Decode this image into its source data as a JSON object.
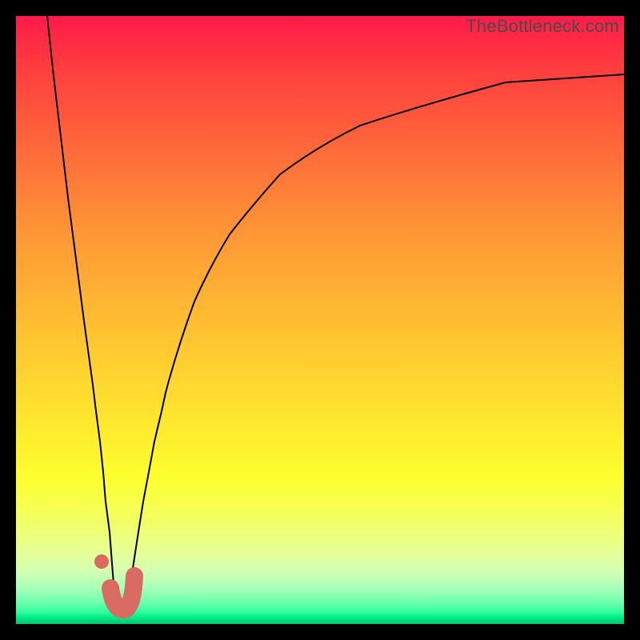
{
  "watermark": "TheBottleneck.com",
  "colors": {
    "frame": "#000000",
    "gradient_top": "#ff1a49",
    "gradient_bottom": "#00c86f",
    "curve": "#000000",
    "marker": "#d96b63"
  },
  "chart_data": {
    "type": "line",
    "title": "",
    "xlabel": "",
    "ylabel": "",
    "xlim": [
      0,
      100
    ],
    "ylim": [
      0,
      100
    ],
    "grid": false,
    "legend": false,
    "note": "Values are read from pixel geometry; axes are unlabeled in the source image so x/y are normalized 0–100.",
    "series": [
      {
        "name": "left-branch",
        "x": [
          5.1,
          6.2,
          7.4,
          8.6,
          9.9,
          11.2,
          12.6,
          13.1,
          13.8,
          14.3,
          14.8,
          15.4
        ],
        "y": [
          100,
          90.1,
          80.1,
          70.1,
          60.0,
          49.9,
          39.3,
          35.0,
          30.0,
          25.0,
          20.1,
          15.1
        ]
      },
      {
        "name": "valley",
        "x": [
          15.4,
          15.8,
          16.3,
          16.8,
          17.1,
          17.6,
          18.4,
          18.9,
          19.3
        ],
        "y": [
          15.1,
          10.0,
          5.1,
          2.0,
          1.3,
          2.0,
          5.1,
          7.5,
          10.0
        ]
      },
      {
        "name": "right-branch",
        "x": [
          19.3,
          20.1,
          20.9,
          21.8,
          22.8,
          23.9,
          24.6,
          25.1,
          27.1,
          29.3,
          32.0,
          35.1,
          38.8,
          43.4,
          49.3,
          57.2,
          68.8,
          80.5,
          100.0
        ],
        "y": [
          10.0,
          15.1,
          20.1,
          25.0,
          30.0,
          35.0,
          38.0,
          40.0,
          47.0,
          53.0,
          58.9,
          64.1,
          68.8,
          73.0,
          77.0,
          80.9,
          84.9,
          87.5,
          90.4
        ]
      }
    ],
    "annotations": [
      {
        "name": "highlight-j-mark",
        "shape": "J",
        "anchor_x": 17.0,
        "anchor_y": 3.0,
        "dot_x": 14.1,
        "dot_y": 10.3
      }
    ]
  }
}
